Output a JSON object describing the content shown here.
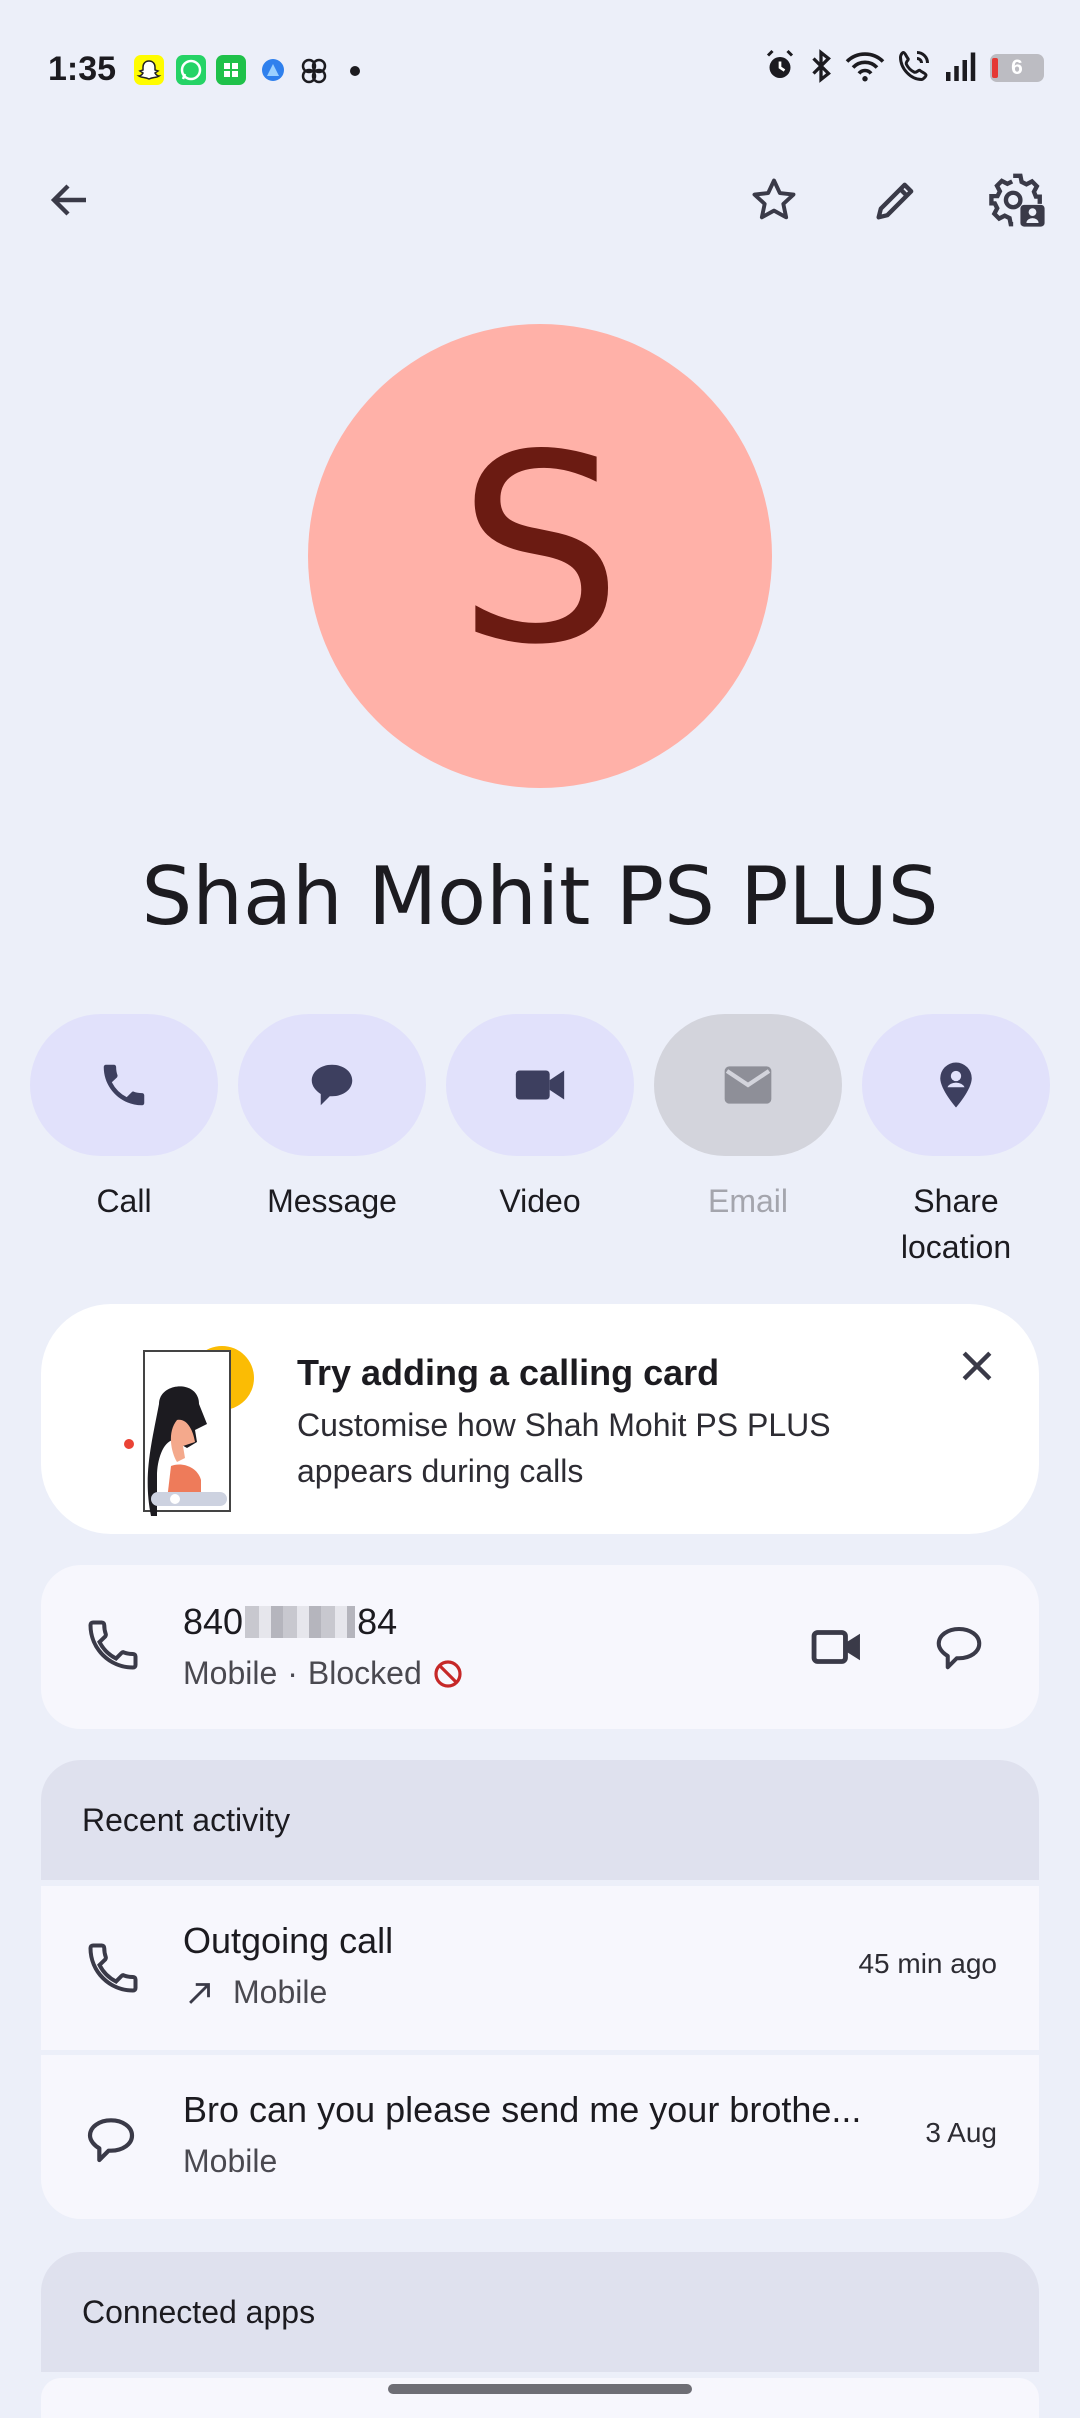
{
  "status_bar": {
    "time": "1:35",
    "battery_level": "6",
    "notification_icons": [
      "snapchat-icon",
      "whatsapp-icon",
      "app-icon",
      "browser-icon",
      "pinwheel-icon",
      "more-dot-icon"
    ],
    "system_icons": [
      "alarm-icon",
      "bluetooth-icon",
      "wifi-icon",
      "wifi-call-icon",
      "signal-icon",
      "battery-icon"
    ]
  },
  "top_bar": {
    "icons": [
      "back-arrow-icon",
      "star-icon",
      "edit-icon",
      "settings-icon"
    ]
  },
  "contact": {
    "initial": "S",
    "name": "Shah Mohit PS PLUS",
    "avatar_color": "#ffb1a8",
    "initial_color": "#6b1b12"
  },
  "actions": [
    {
      "label": "Call",
      "icon": "phone-icon",
      "enabled": true
    },
    {
      "label": "Message",
      "icon": "message-icon",
      "enabled": true
    },
    {
      "label": "Video",
      "icon": "video-icon",
      "enabled": true
    },
    {
      "label": "Email",
      "icon": "email-icon",
      "enabled": false
    },
    {
      "label": "Share location",
      "icon": "location-pin-icon",
      "enabled": true
    }
  ],
  "calling_card": {
    "title": "Try adding a calling card",
    "description": "Customise how Shah Mohit PS PLUS appears during calls"
  },
  "phone": {
    "number_start": "840",
    "number_end": "84",
    "type": "Mobile",
    "separator": "·",
    "status": "Blocked"
  },
  "recent_activity": {
    "title": "Recent activity",
    "items": [
      {
        "title": "Outgoing call",
        "sub": "Mobile",
        "time": "45 min ago",
        "icon": "phone-icon"
      },
      {
        "title": "Bro can you please send me your brothe...",
        "sub": "Mobile",
        "time": "3 Aug",
        "icon": "message-icon"
      }
    ]
  },
  "connected_apps": {
    "title": "Connected apps"
  },
  "colors": {
    "background": "#eceff9",
    "action_pill": "#e1e1fb",
    "action_pill_disabled": "#d3d4dc",
    "icon": "#3d3f5f",
    "blocked_red": "#c62828"
  }
}
